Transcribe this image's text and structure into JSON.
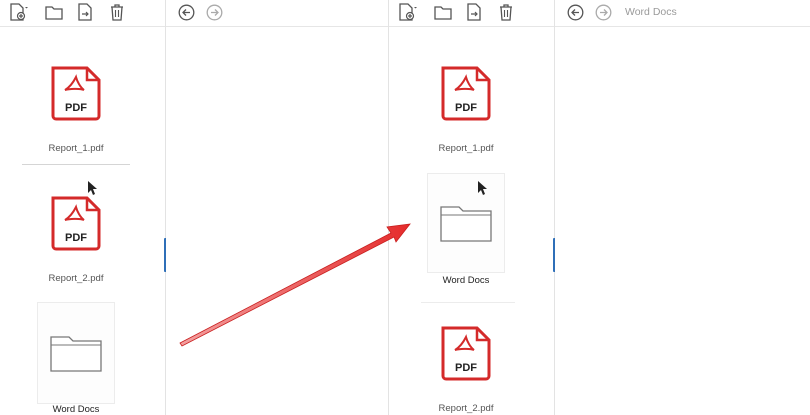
{
  "left_pane": {
    "items": [
      {
        "type": "pdf",
        "name": "Report_1.pdf",
        "pdf_badge": "PDF"
      },
      {
        "type": "pdf",
        "name": "Report_2.pdf",
        "pdf_badge": "PDF"
      },
      {
        "type": "folder",
        "name": "Word Docs"
      }
    ]
  },
  "right_pane": {
    "current_folder": "Word Docs",
    "items": [
      {
        "type": "pdf",
        "name": "Report_1.pdf",
        "pdf_badge": "PDF"
      },
      {
        "type": "folder",
        "name": "Word Docs"
      },
      {
        "type": "pdf",
        "name": "Report_2.pdf",
        "pdf_badge": "PDF"
      }
    ]
  },
  "toolbar": {
    "icons": [
      "new-file-icon",
      "folder-icon",
      "move-file-icon",
      "trash-icon"
    ]
  },
  "navigation": {
    "icons": [
      "back-arrow-icon",
      "forward-arrow-icon"
    ]
  },
  "colors": {
    "pdf_red": "#d42a2a",
    "splitter_blue": "#2f6fb8",
    "annotation_arrow": "#e52b2b"
  }
}
